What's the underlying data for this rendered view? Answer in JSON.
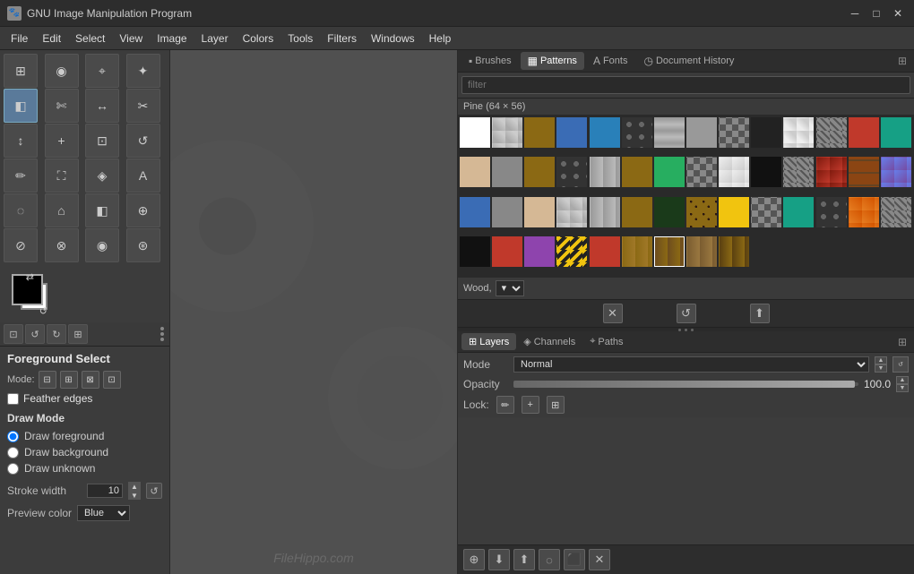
{
  "titlebar": {
    "icon": "🐾",
    "title": "GNU Image Manipulation Program",
    "minimize": "─",
    "maximize": "□",
    "close": "✕"
  },
  "menubar": {
    "items": [
      "File",
      "Edit",
      "Select",
      "View",
      "Image",
      "Layer",
      "Colors",
      "Tools",
      "Filters",
      "Windows",
      "Help"
    ]
  },
  "tools": [
    {
      "icon": "⊞",
      "name": "rect-select"
    },
    {
      "icon": "◉",
      "name": "ellipse-select"
    },
    {
      "icon": "⌖",
      "name": "free-select"
    },
    {
      "icon": "✦",
      "name": "fuzzy-select"
    },
    {
      "icon": "▣",
      "name": "select-by-color"
    },
    {
      "icon": "✄",
      "name": "scissors"
    },
    {
      "icon": "✂",
      "name": "crop"
    },
    {
      "icon": "↔",
      "name": "transform"
    },
    {
      "icon": "↕",
      "name": "move"
    },
    {
      "icon": "+",
      "name": "align"
    },
    {
      "icon": "⊡",
      "name": "flip"
    },
    {
      "icon": "↺",
      "name": "rotate"
    },
    {
      "icon": "✏",
      "name": "pencil"
    },
    {
      "icon": "⛶",
      "name": "paint"
    },
    {
      "icon": "🔲",
      "name": "heal"
    },
    {
      "icon": "A",
      "name": "text"
    },
    {
      "icon": "∿",
      "name": "path"
    },
    {
      "icon": "⌂",
      "name": "measure"
    },
    {
      "icon": "◧",
      "name": "clone"
    },
    {
      "icon": "⬛",
      "name": "smudge"
    },
    {
      "icon": "◉",
      "name": "dodge"
    },
    {
      "icon": "❂",
      "name": "desaturate"
    },
    {
      "icon": "⊕",
      "name": "bucket"
    },
    {
      "icon": "◈",
      "name": "blend"
    },
    {
      "icon": "⊘",
      "name": "eraser"
    },
    {
      "icon": "◌",
      "name": "airbrush"
    },
    {
      "icon": "⊛",
      "name": "ink"
    }
  ],
  "colors": {
    "foreground": "#000000",
    "background": "#ffffff",
    "reset_label": "↺",
    "swap_label": "⇄"
  },
  "tool_options": {
    "title": "Foreground Select",
    "mode_label": "Mode:",
    "feather_edges_label": "Feather edges",
    "feather_edges_checked": false,
    "draw_mode_label": "Draw Mode",
    "draw_foreground_label": "Draw foreground",
    "draw_background_label": "Draw background",
    "draw_unknown_label": "Draw unknown",
    "stroke_width_label": "Stroke width",
    "stroke_width_value": "10",
    "preview_color_label": "Preview color",
    "preview_color_value": "Blue"
  },
  "brush_panel": {
    "tabs": [
      {
        "label": "Brushes",
        "icon": "▪",
        "active": false
      },
      {
        "label": "Patterns",
        "icon": "▦",
        "active": true
      },
      {
        "label": "Fonts",
        "icon": "A",
        "active": false
      },
      {
        "label": "Document History",
        "icon": "◷",
        "active": false
      }
    ],
    "filter_placeholder": "filter",
    "pattern_label": "Pine (64 × 56)",
    "patterns": [
      {
        "class": "pat-white",
        "name": "white"
      },
      {
        "class": "pat-gray-lt",
        "name": "gray-light"
      },
      {
        "class": "pat-wood",
        "name": "wood1"
      },
      {
        "class": "pat-blue",
        "name": "blue1"
      },
      {
        "class": "pat-blue2",
        "name": "blue2"
      },
      {
        "class": "pat-dots",
        "name": "dots1"
      },
      {
        "class": "pat-metal",
        "name": "metal1"
      },
      {
        "class": "pat-concrete",
        "name": "concrete1"
      },
      {
        "class": "pat-check",
        "name": "check1"
      },
      {
        "class": "pat-dark",
        "name": "dark1"
      },
      {
        "class": "pat-marble",
        "name": "marble1"
      },
      {
        "class": "pat-striped",
        "name": "striped1"
      },
      {
        "class": "pat-red",
        "name": "red1"
      },
      {
        "class": "pat-teal",
        "name": "teal1"
      },
      {
        "class": "pat-sand",
        "name": "sand1"
      },
      {
        "class": "pat-concrete",
        "name": "concrete2"
      },
      {
        "class": "pat-wood",
        "name": "wood2"
      },
      {
        "class": "pat-dots",
        "name": "dots2"
      },
      {
        "class": "pat-metal",
        "name": "metal2"
      },
      {
        "class": "pat-leopard",
        "name": "leopard"
      },
      {
        "class": "pat-green",
        "name": "green1"
      },
      {
        "class": "pat-check",
        "name": "check2"
      },
      {
        "class": "pat-marble",
        "name": "marble2"
      },
      {
        "class": "pat-dark",
        "name": "dark2"
      },
      {
        "class": "pat-striped",
        "name": "striped2"
      },
      {
        "class": "pat-rust",
        "name": "rust"
      },
      {
        "class": "pat-brick",
        "name": "brick"
      },
      {
        "class": "pat-gradient",
        "name": "gradient1"
      },
      {
        "class": "pat-blue",
        "name": "blue3"
      },
      {
        "class": "pat-concrete",
        "name": "concrete3"
      },
      {
        "class": "pat-sand",
        "name": "sand2"
      },
      {
        "class": "pat-gray-lt",
        "name": "gray2"
      },
      {
        "class": "pat-metal",
        "name": "metal3"
      },
      {
        "class": "pat-wood",
        "name": "wood3"
      },
      {
        "class": "pat-circuit",
        "name": "circuit"
      },
      {
        "class": "pat-leopard",
        "name": "leopard2"
      },
      {
        "class": "pat-yellow",
        "name": "yellow1"
      },
      {
        "class": "pat-check",
        "name": "check3"
      },
      {
        "class": "pat-teal",
        "name": "teal2"
      },
      {
        "class": "pat-dots",
        "name": "dots3"
      },
      {
        "class": "pat-orange",
        "name": "orange1"
      },
      {
        "class": "pat-striped",
        "name": "striped3"
      },
      {
        "class": "pat-black",
        "name": "black1"
      },
      {
        "class": "pat-rust",
        "name": "rust2"
      },
      {
        "class": "pat-lavender",
        "name": "lavender"
      },
      {
        "class": "pat-selected-yellow",
        "name": "selected-yellow"
      },
      {
        "class": "pat-red",
        "name": "red2"
      },
      {
        "class": "pat-wood",
        "name": "wood4"
      },
      {
        "class": "pat-pine",
        "name": "pine"
      },
      {
        "class": "pat-pine",
        "name": "pine2"
      },
      {
        "class": "pat-pine",
        "name": "pine3"
      }
    ],
    "footer_text": "Wood,",
    "actions": [
      "✕",
      "↺",
      "⬆"
    ]
  },
  "layers_panel": {
    "tabs": [
      {
        "label": "Layers",
        "icon": "⊞",
        "active": true
      },
      {
        "label": "Channels",
        "icon": "◈",
        "active": false
      },
      {
        "label": "Paths",
        "icon": "⌖",
        "active": false
      }
    ],
    "mode_label": "Mode",
    "mode_value": "Normal",
    "opacity_label": "Opacity",
    "opacity_value": "100.0",
    "lock_label": "Lock:",
    "lock_icons": [
      "✏",
      "+",
      "⊞"
    ],
    "footer_buttons": [
      "⊕",
      "⬇",
      "⬆",
      "◌",
      "⬛",
      "✕"
    ]
  },
  "watermark": "FileHippo.com"
}
